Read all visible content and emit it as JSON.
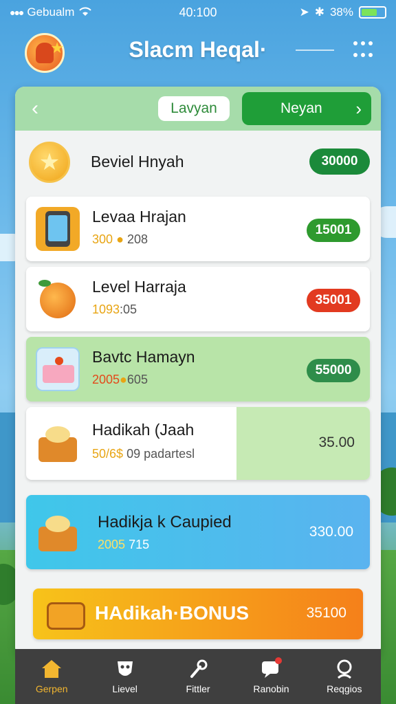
{
  "status_bar": {
    "carrier": "Gebualm",
    "time": "40:100",
    "battery": "38%"
  },
  "header": {
    "title": "Slacm Heqal·"
  },
  "tabs": {
    "tab_a": "Lavyan",
    "tab_b": "Neyan"
  },
  "rows": [
    {
      "name": "Beviel Hnyah",
      "price": "30000",
      "sub": "",
      "pill_color": "#1b8a3a"
    },
    {
      "name": "Levaa Hrajan",
      "sub_gold": "300",
      "sub_rest": "208",
      "price": "15001",
      "pill_color": "#2e9a2e"
    },
    {
      "name": "Level Harraja",
      "sub_gold": "1093",
      "sub_rest": ":05",
      "price": "35001",
      "pill_color": "#e23a20"
    },
    {
      "name": "Bavtc Hamayn",
      "sub_gold": "2005",
      "sub_rest": "605",
      "price": "55000",
      "pill_color": "#2e8d4a"
    },
    {
      "name": "Hadikah (Jaah",
      "sub_gold": "50/6$",
      "sub_rest": "09 padartesl",
      "price": "35.00"
    },
    {
      "name": "Hadikja k Caupied",
      "sub_gold": "2005",
      "sub_rest": "715",
      "price": "330.00"
    },
    {
      "name": "HAdikah·BONUS",
      "price": "35100"
    }
  ],
  "nav": [
    {
      "label": "Gerpen",
      "icon": "home-icon"
    },
    {
      "label": "Lievel",
      "icon": "mask-icon"
    },
    {
      "label": "Fittler",
      "icon": "wrench-icon"
    },
    {
      "label": "Ranobin",
      "icon": "chat-icon"
    },
    {
      "label": "Reqgios",
      "icon": "profile-icon"
    }
  ],
  "colors": {
    "accent_green": "#1f9e38",
    "nav_active": "#f2b630"
  }
}
